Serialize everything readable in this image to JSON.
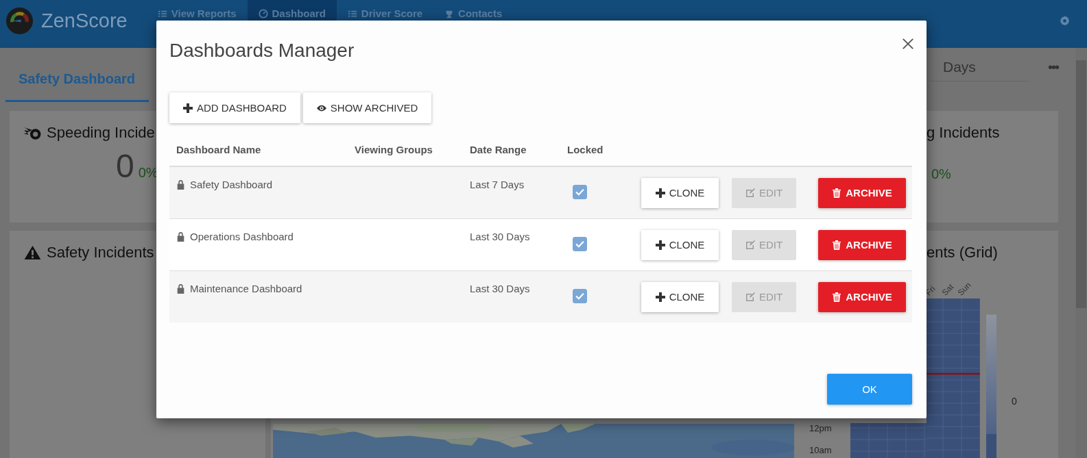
{
  "header": {
    "app_name": "ZenScore",
    "nav": [
      {
        "label": "View Reports",
        "selected": false
      },
      {
        "label": "Dashboard",
        "selected": true
      },
      {
        "label": "Driver Score",
        "selected": false
      },
      {
        "label": "Contacts",
        "selected": false
      }
    ]
  },
  "toolbar": {
    "tab": "Safety Dashboard",
    "date_range": "Days",
    "more": "•••"
  },
  "cards": {
    "speeding": {
      "title": "Speeding Incide",
      "value": "0",
      "change": "0%"
    },
    "right_top": {
      "title": "g Incidents",
      "change": "0%"
    },
    "safety": {
      "title": "Safety Incidents"
    },
    "grid": {
      "title": "ents (Grid)",
      "days": [
        "Fri",
        "Sat",
        "Sun"
      ],
      "hours": [
        "12pm",
        "10am"
      ],
      "scale_label": "0"
    }
  },
  "modal": {
    "title": "Dashboards Manager",
    "actions": [
      {
        "label": "ADD DASHBOARD",
        "kind": "add"
      },
      {
        "label": "SHOW ARCHIVED",
        "kind": "show"
      }
    ],
    "columns": [
      "Dashboard Name",
      "Viewing Groups",
      "Date Range",
      "Locked"
    ],
    "rows": [
      {
        "name": "Safety Dashboard",
        "date_range": "Last 7 Days",
        "locked": true,
        "buttons": [
          {
            "label": "CLONE",
            "kind": "clone",
            "disabled": false
          },
          {
            "label": "EDIT",
            "kind": "edit",
            "disabled": true
          },
          {
            "label": "ARCHIVE",
            "kind": "archive",
            "disabled": false
          }
        ]
      },
      {
        "name": "Operations Dashboard",
        "date_range": "Last 30 Days",
        "locked": true,
        "buttons": [
          {
            "label": "CLONE",
            "kind": "clone",
            "disabled": false
          },
          {
            "label": "EDIT",
            "kind": "edit",
            "disabled": true
          },
          {
            "label": "ARCHIVE",
            "kind": "archive",
            "disabled": false
          }
        ]
      },
      {
        "name": "Maintenance Dashboard",
        "date_range": "Last 30 Days",
        "locked": true,
        "buttons": [
          {
            "label": "CLONE",
            "kind": "clone",
            "disabled": false
          },
          {
            "label": "EDIT",
            "kind": "edit",
            "disabled": true
          },
          {
            "label": "ARCHIVE",
            "kind": "archive",
            "disabled": false
          }
        ]
      }
    ],
    "ok": "OK"
  }
}
